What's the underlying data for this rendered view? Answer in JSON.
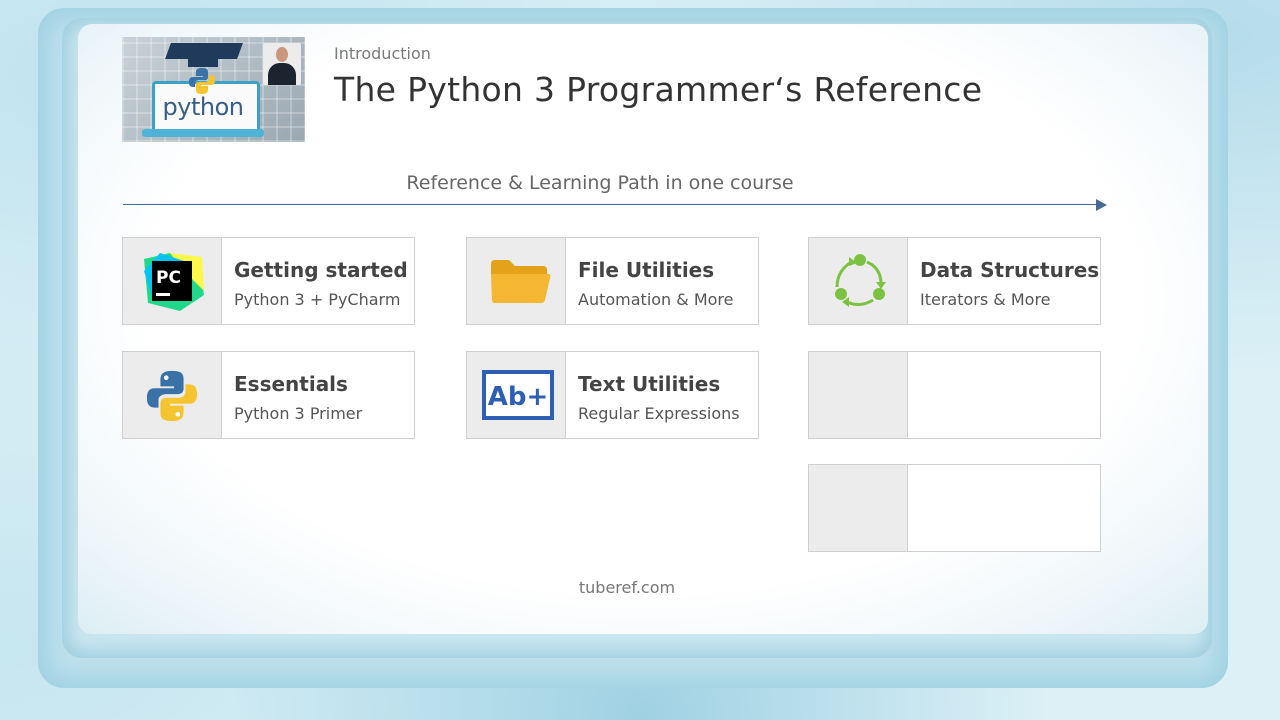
{
  "header": {
    "kicker": "Introduction",
    "title": "The Python 3 Programmer‘s Reference",
    "logo_text": "python"
  },
  "path": {
    "label": "Reference & Learning Path in one course"
  },
  "cards": [
    {
      "title": "Getting started",
      "subtitle": "Python 3 + PyCharm",
      "icon": "pycharm-icon"
    },
    {
      "title": "File Utilities",
      "subtitle": "Automation & More",
      "icon": "folder-icon"
    },
    {
      "title": "Data Structures",
      "subtitle": "Iterators & More",
      "icon": "cycle-icon"
    },
    {
      "title": "Essentials",
      "subtitle": "Python 3 Primer",
      "icon": "python-icon"
    },
    {
      "title": "Text Utilities",
      "subtitle": "Regular Expressions",
      "icon": "text-abplus-icon",
      "icon_text": "Ab+"
    },
    {
      "title": "",
      "subtitle": ""
    },
    {
      "title": "",
      "subtitle": ""
    }
  ],
  "pycharm_icon_text": "PC",
  "footer": {
    "text": "tuberef.com"
  },
  "colors": {
    "accent_line": "#4a6a95",
    "folder": "#f5b731",
    "cycle": "#7cc242",
    "abplus": "#2f5fb3"
  }
}
